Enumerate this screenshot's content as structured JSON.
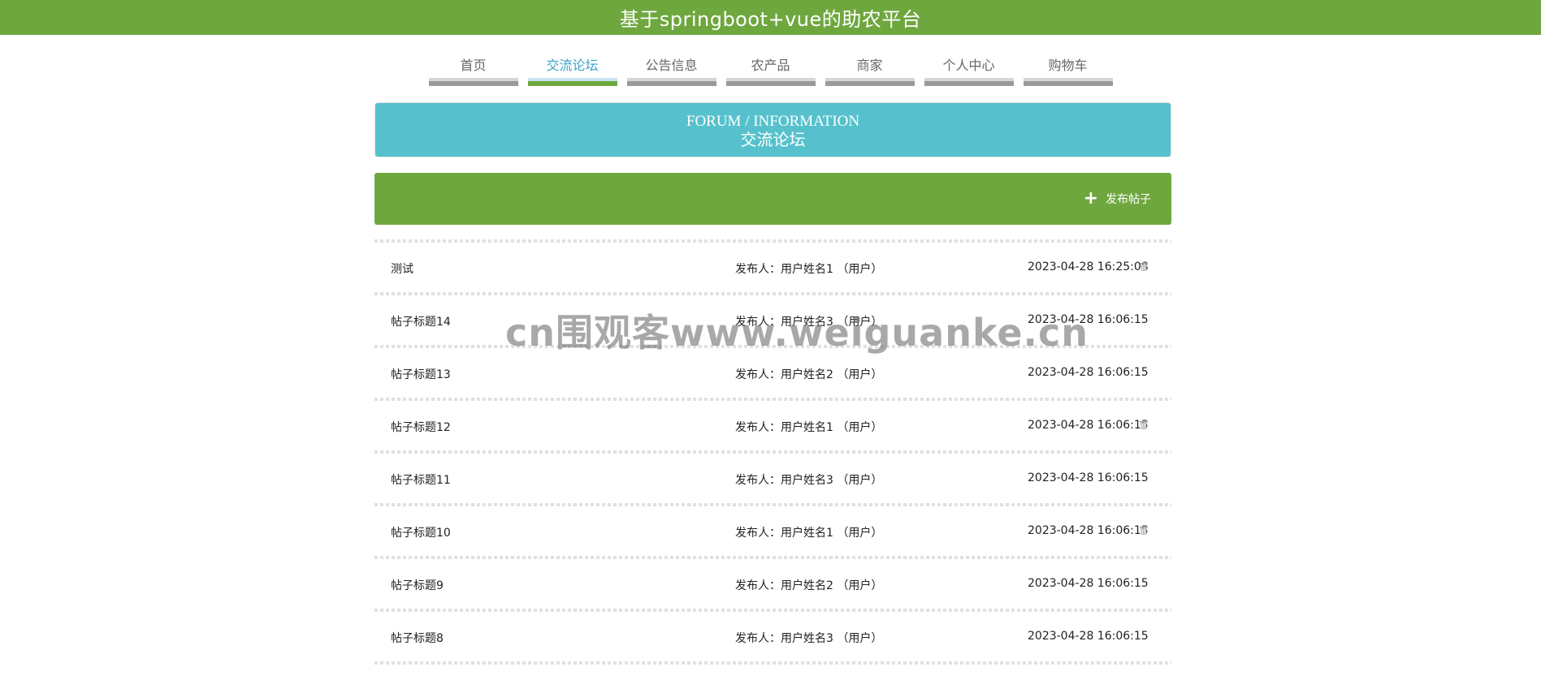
{
  "header": {
    "title": "基于springboot+vue的助农平台"
  },
  "nav": {
    "items": [
      {
        "label": "首页",
        "active": false
      },
      {
        "label": "交流论坛",
        "active": true
      },
      {
        "label": "公告信息",
        "active": false
      },
      {
        "label": "农产品",
        "active": false
      },
      {
        "label": "商家",
        "active": false
      },
      {
        "label": "个人中心",
        "active": false
      },
      {
        "label": "购物车",
        "active": false
      }
    ]
  },
  "banner": {
    "en": "FORUM / INFORMATION",
    "cn": "交流论坛"
  },
  "actions": {
    "publish_label": "发布帖子"
  },
  "posts": [
    {
      "title": "测试",
      "author": "发布人：用户姓名1 （用户）",
      "time": "2023-04-28 16:25:08",
      "deletable": true
    },
    {
      "title": "帖子标题14",
      "author": "发布人：用户姓名3 （用户）",
      "time": "2023-04-28 16:06:15",
      "deletable": false
    },
    {
      "title": "帖子标题13",
      "author": "发布人：用户姓名2 （用户）",
      "time": "2023-04-28 16:06:15",
      "deletable": false
    },
    {
      "title": "帖子标题12",
      "author": "发布人：用户姓名1 （用户）",
      "time": "2023-04-28 16:06:15",
      "deletable": true
    },
    {
      "title": "帖子标题11",
      "author": "发布人：用户姓名3 （用户）",
      "time": "2023-04-28 16:06:15",
      "deletable": false
    },
    {
      "title": "帖子标题10",
      "author": "发布人：用户姓名1 （用户）",
      "time": "2023-04-28 16:06:15",
      "deletable": true
    },
    {
      "title": "帖子标题9",
      "author": "发布人：用户姓名2 （用户）",
      "time": "2023-04-28 16:06:15",
      "deletable": false
    },
    {
      "title": "帖子标题8",
      "author": "发布人：用户姓名3 （用户）",
      "time": "2023-04-28 16:06:15",
      "deletable": false
    }
  ],
  "watermark": "cn围观客www.weiguanke.cn",
  "colors": {
    "primary_green": "#6fa73f",
    "banner_teal": "#56c1cc",
    "active_nav_text": "#3ba3c9"
  },
  "icons": {
    "publish": "plus-icon",
    "delete": "trash-icon"
  }
}
